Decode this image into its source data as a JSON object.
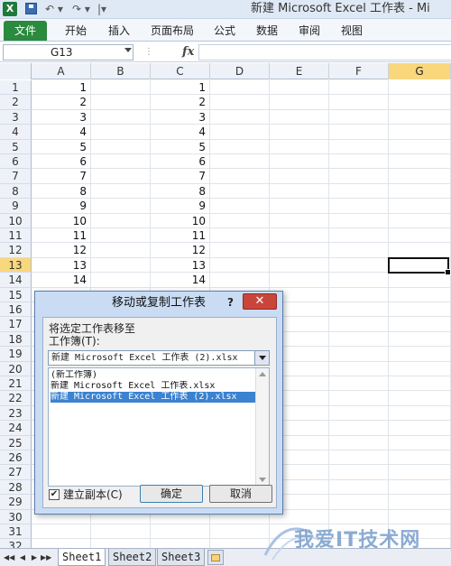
{
  "window": {
    "title": "新建 Microsoft Excel 工作表 - Mi",
    "app_icon": "X"
  },
  "qat": {
    "undo": "↶ ▾",
    "redo": "↷ ▾",
    "customize": "|▾"
  },
  "ribbon": {
    "tabs": [
      "文件",
      "开始",
      "插入",
      "页面布局",
      "公式",
      "数据",
      "审阅",
      "视图"
    ]
  },
  "formula_bar": {
    "name_box": "G13",
    "fx": "fx",
    "content": ""
  },
  "grid": {
    "columns": [
      "A",
      "B",
      "C",
      "D",
      "E",
      "F",
      "G"
    ],
    "selected_column": "G",
    "selected_row": "13",
    "rows": [
      {
        "n": "1",
        "a": "1",
        "c": "1"
      },
      {
        "n": "2",
        "a": "2",
        "c": "2"
      },
      {
        "n": "3",
        "a": "3",
        "c": "3"
      },
      {
        "n": "4",
        "a": "4",
        "c": "4"
      },
      {
        "n": "5",
        "a": "5",
        "c": "5"
      },
      {
        "n": "6",
        "a": "6",
        "c": "6"
      },
      {
        "n": "7",
        "a": "7",
        "c": "7"
      },
      {
        "n": "8",
        "a": "8",
        "c": "8"
      },
      {
        "n": "9",
        "a": "9",
        "c": "9"
      },
      {
        "n": "10",
        "a": "10",
        "c": "10"
      },
      {
        "n": "11",
        "a": "11",
        "c": "11"
      },
      {
        "n": "12",
        "a": "12",
        "c": "12"
      },
      {
        "n": "13",
        "a": "13",
        "c": "13"
      },
      {
        "n": "14",
        "a": "14",
        "c": "14"
      },
      {
        "n": "15",
        "a": "",
        "c": ""
      },
      {
        "n": "16",
        "a": "",
        "c": ""
      },
      {
        "n": "17",
        "a": "",
        "c": ""
      },
      {
        "n": "18",
        "a": "",
        "c": ""
      },
      {
        "n": "19",
        "a": "",
        "c": ""
      },
      {
        "n": "20",
        "a": "",
        "c": ""
      },
      {
        "n": "21",
        "a": "",
        "c": ""
      },
      {
        "n": "22",
        "a": "",
        "c": ""
      },
      {
        "n": "23",
        "a": "",
        "c": ""
      },
      {
        "n": "24",
        "a": "",
        "c": ""
      },
      {
        "n": "25",
        "a": "",
        "c": ""
      },
      {
        "n": "26",
        "a": "",
        "c": ""
      },
      {
        "n": "27",
        "a": "",
        "c": ""
      },
      {
        "n": "28",
        "a": "",
        "c": ""
      },
      {
        "n": "29",
        "a": "",
        "c": ""
      },
      {
        "n": "30",
        "a": "",
        "c": ""
      },
      {
        "n": "31",
        "a": "",
        "c": ""
      },
      {
        "n": "32",
        "a": "",
        "c": ""
      }
    ]
  },
  "sheets": {
    "nav": [
      "◀◀",
      "◀",
      "▶",
      "▶▶"
    ],
    "tabs": [
      "Sheet1",
      "Sheet2",
      "Sheet3"
    ],
    "active": "Sheet1"
  },
  "dialog": {
    "title": "移动或复制工作表",
    "help": "?",
    "close": "✕",
    "move_label": "将选定工作表移至",
    "book_label": "工作簿(T):",
    "book_selected": "新建 Microsoft Excel 工作表 (2).xlsx",
    "book_options": [
      "(新工作簿)",
      "新建 Microsoft Excel 工作表.xlsx",
      "新建 Microsoft Excel 工作表 (2).xlsx"
    ],
    "selected_index": 2,
    "copy_checked": "✔",
    "copy_label": "建立副本(C)",
    "ok": "确定",
    "cancel": "取消"
  },
  "watermark": {
    "text": "我爱IT技术网"
  },
  "colors": {
    "file_tab": "#2a8a3e",
    "selection_header": "#f9d77d",
    "dialog_frame": "#c9dcf3",
    "close_button": "#c9453a"
  }
}
